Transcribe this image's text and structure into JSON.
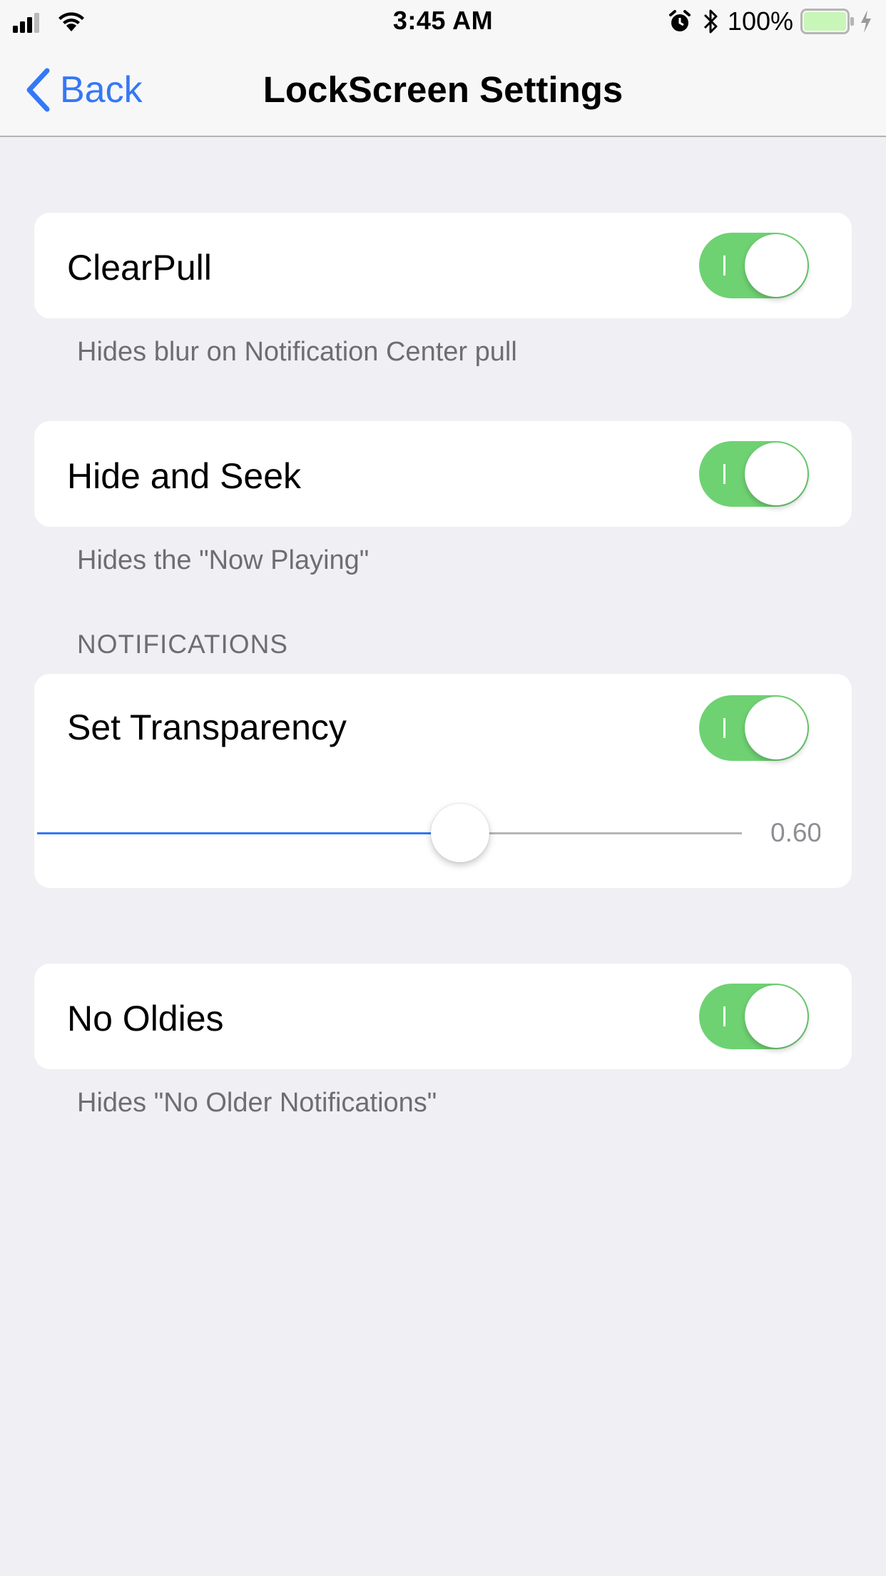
{
  "status_bar": {
    "time": "3:45 AM",
    "battery_percent": "100%",
    "icons": [
      "signal-icon",
      "wifi-icon",
      "alarm-icon",
      "bluetooth-icon",
      "battery-icon",
      "charging-icon"
    ]
  },
  "nav": {
    "back_label": "Back",
    "title": "LockScreen Settings"
  },
  "rows": {
    "clearpull": {
      "label": "ClearPull",
      "footer": "Hides blur on Notification Center pull",
      "on": true
    },
    "hide_and_seek": {
      "label": "Hide and Seek",
      "footer": "Hides the \"Now Playing\"",
      "on": true
    },
    "notifications_header": "NOTIFICATIONS",
    "set_transparency": {
      "label": "Set Transparency",
      "on": true,
      "slider_value": 0.6,
      "slider_display": "0.60"
    },
    "no_oldies": {
      "label": "No Oldies",
      "footer": "Hides \"No Older Notifications\"",
      "on": true
    }
  },
  "colors": {
    "accent": "#3478f6",
    "toggle_on": "#6ed272",
    "background": "#efeff4",
    "footer_text": "#6d6d72"
  }
}
